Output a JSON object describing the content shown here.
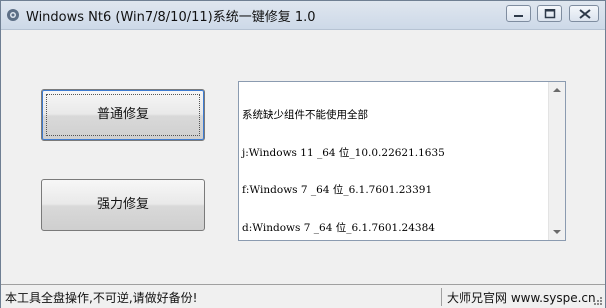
{
  "window": {
    "title": "Windows Nt6 (Win7/8/10/11)系统一键修复 1.0",
    "icon": "gear-app-icon",
    "controls": [
      "minimize-icon",
      "maximize-icon",
      "close-icon"
    ]
  },
  "actions": {
    "normal_repair_label": "普通修复",
    "force_repair_label": "强力修复"
  },
  "log": {
    "lines": [
      "系统缺少组件不能使用全部",
      "j:Windows 11 _64 位_10.0.22621.1635",
      "f:Windows 7 _64 位_6.1.7601.23391",
      "d:Windows 7 _64 位_6.1.7601.24384"
    ]
  },
  "status": {
    "warning": "本工具全盘操作,不可逆,请做好备份!",
    "credit": "大师兄官网 www.syspe.cn"
  }
}
